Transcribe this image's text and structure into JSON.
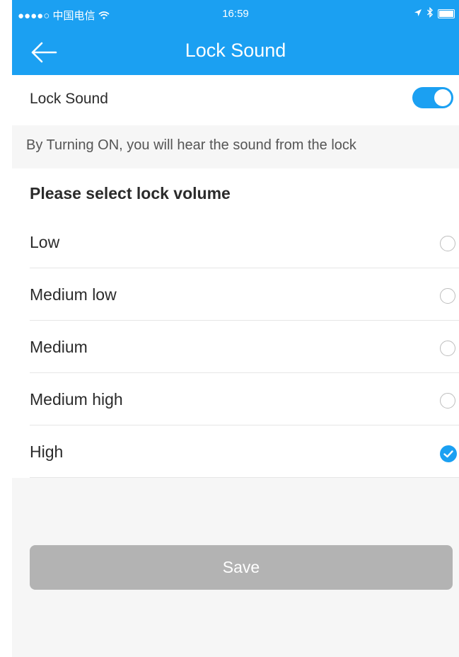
{
  "status_bar": {
    "carrier": "●●●●○ 中国电信",
    "wifi_icon": "wifi-icon",
    "time": "16:59",
    "location_icon": "location-arrow-icon",
    "bluetooth_icon": "bluetooth-icon",
    "battery_icon": "battery-icon"
  },
  "nav": {
    "title": "Lock Sound",
    "back_icon": "back-arrow-icon"
  },
  "lock_sound": {
    "label": "Lock Sound",
    "enabled": true,
    "hint": "By Turning ON, you will hear the sound from the lock"
  },
  "volume": {
    "heading": "Please select lock volume",
    "selected": "High",
    "options": [
      {
        "label": "Low",
        "selected": false
      },
      {
        "label": "Medium low",
        "selected": false
      },
      {
        "label": "Medium",
        "selected": false
      },
      {
        "label": "Medium high",
        "selected": false
      },
      {
        "label": "High",
        "selected": true
      }
    ]
  },
  "save_button": {
    "label": "Save"
  },
  "colors": {
    "accent": "#1ba0f2",
    "background": "#f6f6f6",
    "button_disabled": "#b3b3b3",
    "divider": "#e6e6e6"
  }
}
